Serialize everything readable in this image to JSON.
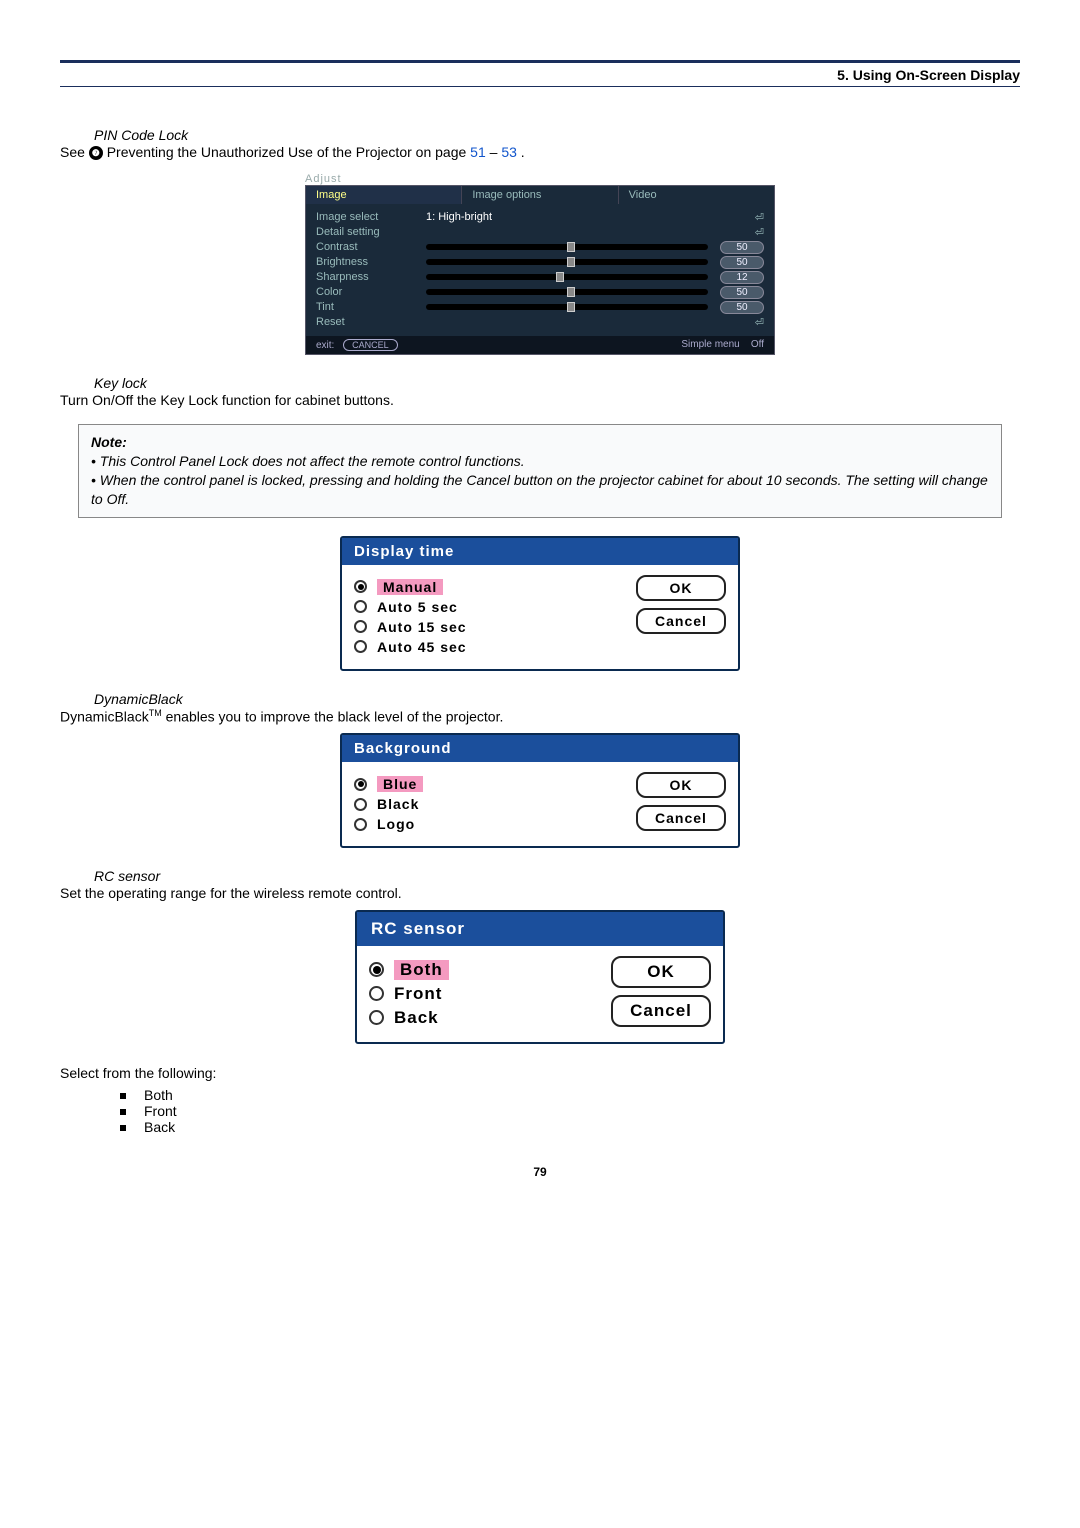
{
  "header": {
    "section_title": "5. Using On-Screen Display"
  },
  "pin": {
    "title": "PIN Code Lock",
    "desc_pre": "See ",
    "desc_post": " Preventing the Unauthorized Use of the Projector on page ",
    "p1": "51",
    "dash": " – ",
    "p2": "53",
    "end": "."
  },
  "adjust": {
    "title": "Adjust",
    "tabs": {
      "t1": "Image",
      "t2": "Image options",
      "t3": "Video"
    },
    "rows": {
      "image_select": {
        "label": "Image select",
        "value": "1: High-bright"
      },
      "detail": {
        "label": "Detail setting"
      },
      "contrast": {
        "label": "Contrast",
        "val": "50"
      },
      "brightness": {
        "label": "Brightness",
        "val": "50"
      },
      "sharpness": {
        "label": "Sharpness",
        "val": "12"
      },
      "color": {
        "label": "Color",
        "val": "50"
      },
      "tint": {
        "label": "Tint",
        "val": "50"
      },
      "reset": {
        "label": "Reset"
      }
    },
    "footer": {
      "exit": "exit:",
      "cancel": "CANCEL",
      "simple": "Simple menu",
      "off": "Off"
    }
  },
  "keylock": {
    "title": "Key lock",
    "desc": "Turn On/Off the Key Lock function for cabinet buttons."
  },
  "note": {
    "title": "Note:",
    "b1": "• This Control Panel Lock does not affect the remote control functions.",
    "b2": "• When the control panel is locked, pressing and holding the Cancel button on the projector cabinet for about 10 seconds. The setting will change to Off."
  },
  "display_time": {
    "head": "Display time",
    "o1": "Manual",
    "o2": "Auto 5 sec",
    "o3": "Auto 15 sec",
    "o4": "Auto 45 sec",
    "ok": "OK",
    "cancel": "Cancel"
  },
  "dynamicblack": {
    "title": "DynamicBlack",
    "desc_pre": "DynamicBlack",
    "tm": "TM",
    "desc_post": " enables you to improve the black level of the projector."
  },
  "background": {
    "head": "Background",
    "o1": "Blue",
    "o2": "Black",
    "o3": "Logo",
    "ok": "OK",
    "cancel": "Cancel"
  },
  "rc": {
    "title": "RC sensor",
    "desc": "Set the operating range for the wireless remote control.",
    "head": "RC sensor",
    "o1": "Both",
    "o2": "Front",
    "o3": "Back",
    "ok": "OK",
    "cancel": "Cancel",
    "select_text": "Select from the following:",
    "li1": "Both",
    "li2": "Front",
    "li3": "Back"
  },
  "page_number": "79"
}
